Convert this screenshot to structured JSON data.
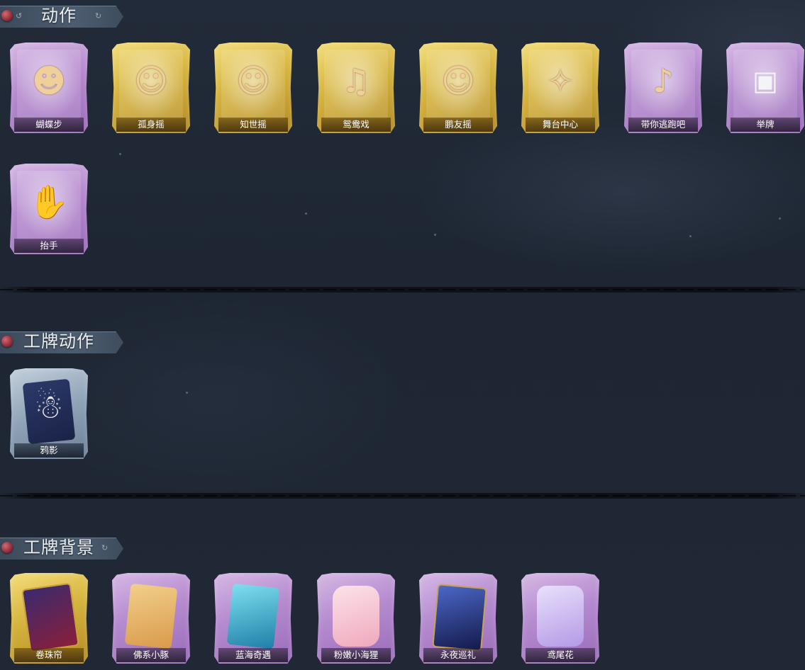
{
  "sections": [
    {
      "title": "动作",
      "items": [
        {
          "label": "蝴蝶步",
          "frame": "purple",
          "icon": "butterfly-step-figure-icon"
        },
        {
          "label": "孤身摇",
          "frame": "gold",
          "icon": "solo-sway-figure-icon"
        },
        {
          "label": "知世摇",
          "frame": "gold",
          "icon": "zhishi-sway-figure-icon"
        },
        {
          "label": "鸳鸯戏",
          "frame": "gold",
          "icon": "mandarin-duck-figure-icon"
        },
        {
          "label": "鹏友摇",
          "frame": "gold",
          "icon": "friend-sway-figure-icon"
        },
        {
          "label": "舞台中心",
          "frame": "gold",
          "icon": "stage-center-figure-icon"
        },
        {
          "label": "带你逃跑吧",
          "frame": "purple",
          "icon": "run-away-figure-icon"
        },
        {
          "label": "举牌",
          "frame": "purple",
          "icon": "hold-sign-figure-icon"
        },
        {
          "label": "抬手",
          "frame": "purple",
          "icon": "raise-hand-figure-icon"
        }
      ]
    },
    {
      "title": "工牌动作",
      "items": [
        {
          "label": "鸦影",
          "frame": "blue",
          "icon": "crow-shadow-badge-icon"
        }
      ]
    },
    {
      "title": "工牌背景",
      "items": [
        {
          "label": "卷珠帘",
          "frame": "gold",
          "icon": "bead-curtain-background-icon"
        },
        {
          "label": "佛系小豚",
          "frame": "purple",
          "icon": "buddha-piglet-background-icon"
        },
        {
          "label": "蓝海奇遇",
          "frame": "purple",
          "icon": "blue-sea-background-icon"
        },
        {
          "label": "粉嫩小海狸",
          "frame": "purple",
          "icon": "pink-beaver-background-icon"
        },
        {
          "label": "永夜巡礼",
          "frame": "purple",
          "icon": "eternal-night-background-icon"
        },
        {
          "label": "鸢尾花",
          "frame": "purple",
          "icon": "iris-background-icon"
        }
      ]
    }
  ]
}
